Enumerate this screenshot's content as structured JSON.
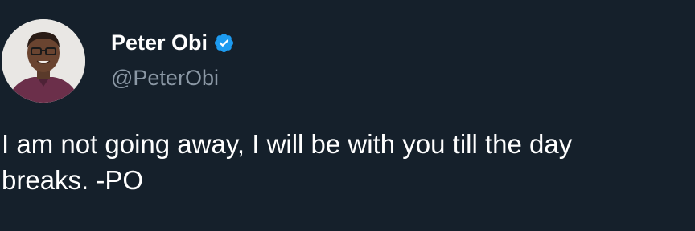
{
  "author": {
    "display_name": "Peter Obi",
    "handle": "@PeterObi",
    "verified": true,
    "avatar_icon": "profile-photo"
  },
  "tweet": {
    "lines": [
      "I am not going away, I will be with you till the day",
      "breaks. -PO"
    ]
  },
  "colors": {
    "background": "#15202b",
    "text": "#ffffff",
    "handle": "#8b98a5",
    "verified_badge": "#1d9bf0"
  }
}
